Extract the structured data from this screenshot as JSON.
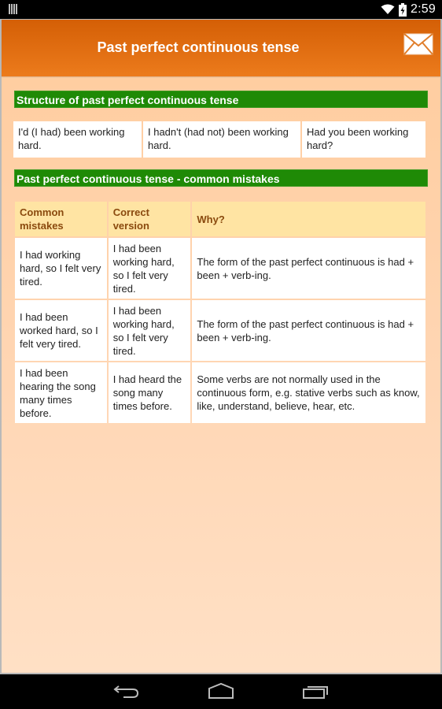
{
  "status_bar": {
    "time": "2:59",
    "icons": [
      "notification-bars-icon",
      "wifi-icon",
      "battery-charging-icon"
    ]
  },
  "header": {
    "title": "Past perfect continuous tense",
    "action_icon": "mail-icon"
  },
  "structure_section": {
    "title": "Structure of past perfect continuous tense",
    "cells": [
      "I'd (I had) been working hard.",
      "I hadn't (had not) been working hard.",
      "Had you been working hard?"
    ]
  },
  "mistakes_section": {
    "title": "Past perfect continuous tense - common mistakes",
    "columns": [
      "Common mistakes",
      "Correct version",
      "Why?"
    ],
    "rows": [
      {
        "mistake": "I had working hard, so I felt very tired.",
        "correct": "I had been working hard, so I felt very tired.",
        "why": "The form of the past perfect continuous is had + been + verb-ing."
      },
      {
        "mistake": "I had been worked hard, so I felt very tired.",
        "correct": "I had been working hard, so I felt very tired.",
        "why": "The form of the past perfect continuous is had + been + verb-ing."
      },
      {
        "mistake": "I had been hearing the song many times before.",
        "correct": "I had heard the song many times before.",
        "why": "Some verbs are not normally used in the continuous form, e.g. stative verbs such as know, like, understand, believe, hear, etc."
      }
    ]
  },
  "nav_bar": {
    "buttons": [
      "back-icon",
      "home-icon",
      "recents-icon"
    ]
  },
  "colors": {
    "header_top": "#d45f06",
    "header_bottom": "#ec7b1c",
    "section_green": "#1f8a06",
    "table_header_bg": "#ffe4a3",
    "table_header_text": "#8a4a0e",
    "page_bg": "#ffd6b4"
  }
}
